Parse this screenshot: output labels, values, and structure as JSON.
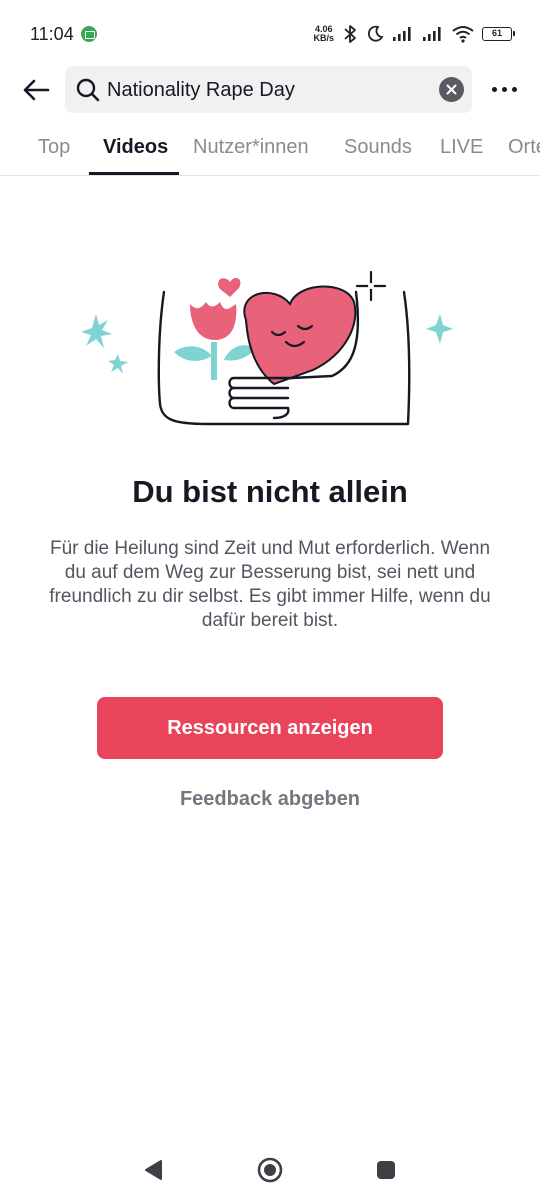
{
  "status_bar": {
    "time": "11:04",
    "net_speed_value": "4.06",
    "net_speed_unit": "KB/s",
    "battery": "61"
  },
  "search": {
    "query": "Nationality Rape Day"
  },
  "tabs": [
    {
      "label": "Top",
      "active": false
    },
    {
      "label": "Videos",
      "active": true
    },
    {
      "label": "Nutzer*innen",
      "active": false
    },
    {
      "label": "Sounds",
      "active": false
    },
    {
      "label": "LIVE",
      "active": false
    },
    {
      "label": "Orte",
      "active": false
    }
  ],
  "main": {
    "headline": "Du bist nicht allein",
    "description": "Für die Heilung sind Zeit und Mut erforderlich. Wenn du auf dem Weg zur Besserung bist, sei nett und freundlich zu dir selbst. Es gibt immer Hilfe, wenn du dafür bereit bist.",
    "resources_button": "Ressourcen anzeigen",
    "feedback_link": "Feedback abgeben"
  },
  "colors": {
    "accent": "#e9445a",
    "heart": "#e8627a",
    "sparkle": "#7fd3d3"
  },
  "icons": {
    "back": "back-arrow-icon",
    "search": "search-icon",
    "clear": "clear-icon",
    "more": "more-dots-icon",
    "nav_back": "nav-back-icon",
    "nav_home": "nav-home-icon",
    "nav_recents": "nav-recents-icon"
  }
}
